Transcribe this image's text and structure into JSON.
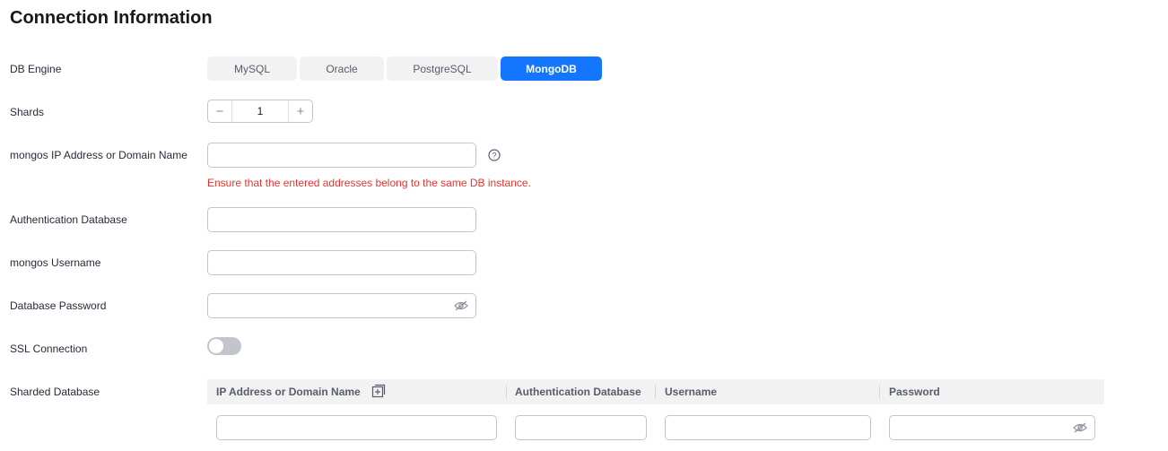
{
  "page": {
    "title": "Connection Information"
  },
  "form": {
    "db_engine": {
      "label": "DB Engine",
      "options": [
        "MySQL",
        "Oracle",
        "PostgreSQL",
        "MongoDB"
      ],
      "selected": "MongoDB"
    },
    "shards": {
      "label": "Shards",
      "value": "1",
      "decrement_icon": "minus-icon",
      "increment_icon": "plus-icon"
    },
    "mongos_ip": {
      "label": "mongos IP Address or Domain Name",
      "value": "",
      "help_icon": "question-circle-icon",
      "error": "Ensure that the entered addresses belong to the same DB instance."
    },
    "auth_db": {
      "label": "Authentication Database",
      "value": ""
    },
    "mongos_username": {
      "label": "mongos Username",
      "value": ""
    },
    "db_password": {
      "label": "Database Password",
      "value": "",
      "icon": "eye-hidden-icon"
    },
    "ssl": {
      "label": "SSL Connection",
      "enabled": false
    },
    "sharded_db": {
      "label": "Sharded Database",
      "columns": [
        "IP Address or Domain Name",
        "Authentication Database",
        "Username",
        "Password"
      ],
      "add_icon": "add-row-icon",
      "rows": [
        {
          "ip": "",
          "auth_db": "",
          "username": "",
          "password": ""
        }
      ]
    }
  },
  "colors": {
    "accent": "#1476ff",
    "error": "#e8332e",
    "border": "#c2c6cc",
    "muted_bg": "#f2f2f2"
  }
}
